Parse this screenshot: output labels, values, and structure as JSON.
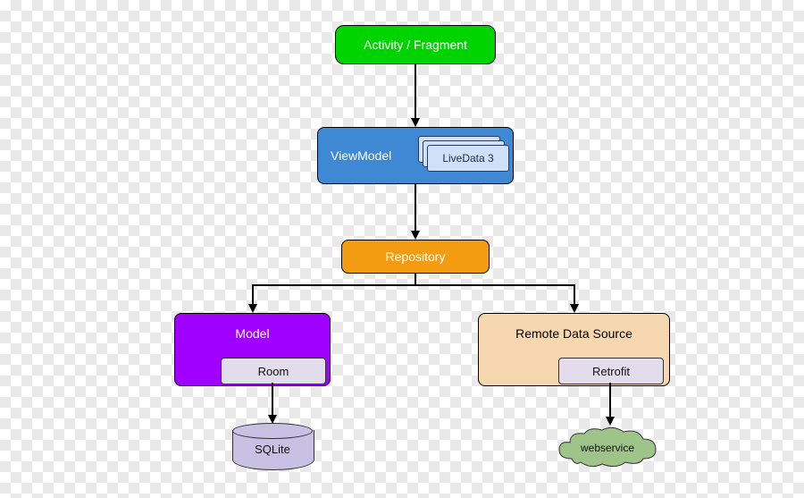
{
  "nodes": {
    "activity": "Activity / Fragment",
    "viewmodel": "ViewModel",
    "livedata": "LiveData 3",
    "repository": "Repository",
    "model": "Model",
    "room": "Room",
    "remote": "Remote Data Source",
    "retrofit": "Retrofit",
    "sqlite": "SQLite",
    "webservice": "webservice"
  },
  "colors": {
    "activity": "#00d400",
    "viewmodel": "#3f88d4",
    "livedata": "#cfe0f7",
    "repository": "#f39c12",
    "model": "#a000ff",
    "remote": "#f7d7b0",
    "tag": "#e3dcec",
    "cylinder": "#c9c1e4",
    "cloud": "#9fc48a"
  },
  "edges": [
    {
      "from": "activity",
      "to": "viewmodel"
    },
    {
      "from": "viewmodel",
      "to": "repository"
    },
    {
      "from": "repository",
      "to": "model"
    },
    {
      "from": "repository",
      "to": "remote"
    },
    {
      "from": "room",
      "to": "sqlite"
    },
    {
      "from": "retrofit",
      "to": "webservice"
    }
  ]
}
